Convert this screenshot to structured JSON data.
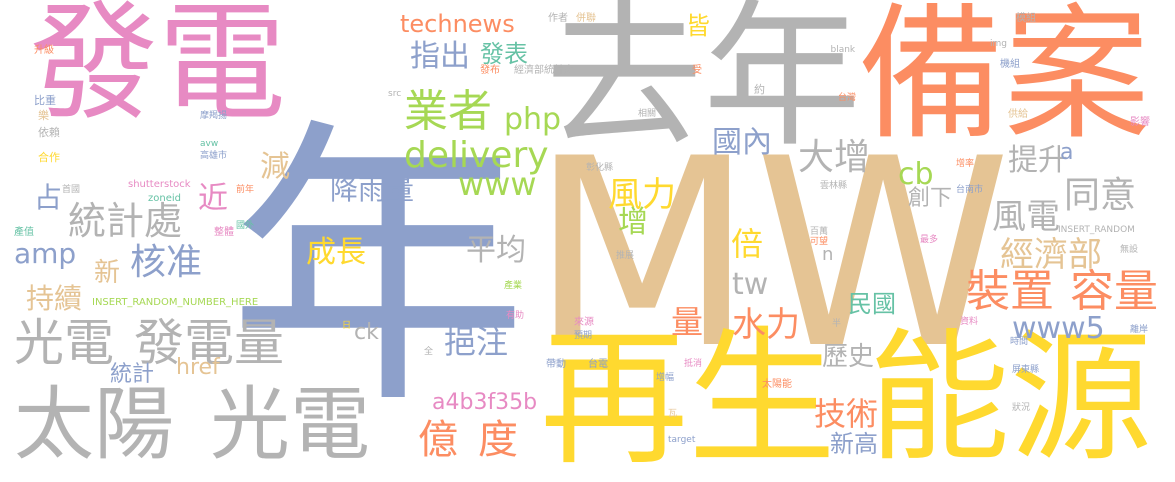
{
  "colors": {
    "pink": "#e78ac3",
    "orange": "#fc8d62",
    "gray": "#b3b3b3",
    "blue": "#8da0cb",
    "green": "#a6d854",
    "yellow": "#ffd92f",
    "tan": "#e5c494",
    "teal": "#66c2a5"
  },
  "words": [
    {
      "text": "發電",
      "color": "pink"
    },
    {
      "text": "去年",
      "color": "gray"
    },
    {
      "text": "備案",
      "color": "orange"
    },
    {
      "text": "年",
      "color": "blue"
    },
    {
      "text": "MW",
      "color": "tan"
    },
    {
      "text": "再生",
      "color": "yellow"
    },
    {
      "text": "能源",
      "color": "yellow"
    },
    {
      "text": "太陽",
      "color": "gray"
    },
    {
      "text": "光電",
      "color": "gray"
    },
    {
      "text": "光電",
      "color": "gray"
    },
    {
      "text": "發電量",
      "color": "gray"
    },
    {
      "text": "統計處",
      "color": "gray"
    },
    {
      "text": "核准",
      "color": "blue"
    },
    {
      "text": "業者",
      "color": "green"
    },
    {
      "text": "delivery",
      "color": "green"
    },
    {
      "text": "www",
      "color": "green"
    },
    {
      "text": "php",
      "color": "green"
    },
    {
      "text": "technews",
      "color": "orange"
    },
    {
      "text": "指出",
      "color": "blue"
    },
    {
      "text": "發表",
      "color": "teal"
    },
    {
      "text": "皆",
      "color": "yellow"
    },
    {
      "text": "國內",
      "color": "blue"
    },
    {
      "text": "大增",
      "color": "gray"
    },
    {
      "text": "提升",
      "color": "gray"
    },
    {
      "text": "同意",
      "color": "gray"
    },
    {
      "text": "風電",
      "color": "gray"
    },
    {
      "text": "經濟部",
      "color": "tan"
    },
    {
      "text": "cb",
      "color": "green"
    },
    {
      "text": "創下",
      "color": "gray"
    },
    {
      "text": "a",
      "color": "blue"
    },
    {
      "text": "風力",
      "color": "yellow"
    },
    {
      "text": "增",
      "color": "green"
    },
    {
      "text": "倍",
      "color": "yellow"
    },
    {
      "text": "裝置",
      "color": "orange"
    },
    {
      "text": "容量",
      "color": "orange"
    },
    {
      "text": "降雨量",
      "color": "blue"
    },
    {
      "text": "減",
      "color": "tan"
    },
    {
      "text": "近",
      "color": "pink"
    },
    {
      "text": "占",
      "color": "blue"
    },
    {
      "text": "amp",
      "color": "blue"
    },
    {
      "text": "新",
      "color": "tan"
    },
    {
      "text": "成長",
      "color": "yellow"
    },
    {
      "text": "平均",
      "color": "gray"
    },
    {
      "text": "持續",
      "color": "tan"
    },
    {
      "text": "tw",
      "color": "gray"
    },
    {
      "text": "n",
      "color": "gray"
    },
    {
      "text": "民國",
      "color": "teal"
    },
    {
      "text": "量",
      "color": "orange"
    },
    {
      "text": "水力",
      "color": "orange"
    },
    {
      "text": "www5",
      "color": "blue"
    },
    {
      "text": "ck",
      "color": "gray"
    },
    {
      "text": "挹注",
      "color": "blue"
    },
    {
      "text": "歷史",
      "color": "gray"
    },
    {
      "text": "統計",
      "color": "blue"
    },
    {
      "text": "href",
      "color": "tan"
    },
    {
      "text": "a4b3f35b",
      "color": "pink"
    },
    {
      "text": "億",
      "color": "orange"
    },
    {
      "text": "度",
      "color": "orange"
    },
    {
      "text": "技術",
      "color": "orange"
    },
    {
      "text": "新高",
      "color": "blue"
    },
    {
      "text": "升級",
      "color": "orange"
    },
    {
      "text": "比重",
      "color": "blue"
    },
    {
      "text": "樂",
      "color": "tan"
    },
    {
      "text": "依賴",
      "color": "gray"
    },
    {
      "text": "合作",
      "color": "yellow"
    },
    {
      "text": "首國",
      "color": "gray"
    },
    {
      "text": "產值",
      "color": "teal"
    },
    {
      "text": "INSERT_RANDOM_NUMBER_HERE",
      "color": "green"
    },
    {
      "text": "作者",
      "color": "gray"
    },
    {
      "text": "併聯",
      "color": "tan"
    },
    {
      "text": "發布",
      "color": "orange"
    },
    {
      "text": "經濟部統計處",
      "color": "gray"
    },
    {
      "text": "src",
      "color": "gray"
    },
    {
      "text": "受",
      "color": "orange"
    },
    {
      "text": "約",
      "color": "gray"
    },
    {
      "text": "相關",
      "color": "gray"
    },
    {
      "text": "_blank",
      "color": "gray"
    },
    {
      "text": "模組",
      "color": "gray"
    },
    {
      "text": "img",
      "color": "gray"
    },
    {
      "text": "機組",
      "color": "blue"
    },
    {
      "text": "台灣",
      "color": "orange"
    },
    {
      "text": "供給",
      "color": "tan"
    },
    {
      "text": "影響",
      "color": "pink"
    },
    {
      "text": "摩羯揚",
      "color": "blue"
    },
    {
      "text": "avw",
      "color": "teal"
    },
    {
      "text": "高雄市",
      "color": "blue"
    },
    {
      "text": "shutterstock",
      "color": "pink"
    },
    {
      "text": "zoneid",
      "color": "teal"
    },
    {
      "text": "前年",
      "color": "orange"
    },
    {
      "text": "彰化縣",
      "color": "gray"
    },
    {
      "text": "雲林縣",
      "color": "gray"
    },
    {
      "text": "增率",
      "color": "orange"
    },
    {
      "text": "台南市",
      "color": "blue"
    },
    {
      "text": "國外",
      "color": "teal"
    },
    {
      "text": "整體",
      "color": "pink"
    },
    {
      "text": "百萬",
      "color": "gray"
    },
    {
      "text": "可望",
      "color": "orange"
    },
    {
      "text": "最多",
      "color": "pink"
    },
    {
      "text": "INSERT_RANDOM",
      "color": "gray"
    },
    {
      "text": "無設",
      "color": "gray"
    },
    {
      "text": "推展",
      "color": "gray"
    },
    {
      "text": "產業",
      "color": "green"
    },
    {
      "text": "有助",
      "color": "pink"
    },
    {
      "text": "來源",
      "color": "pink"
    },
    {
      "text": "預期",
      "color": "blue"
    },
    {
      "text": "半",
      "color": "gray"
    },
    {
      "text": "資料",
      "color": "pink"
    },
    {
      "text": "離岸",
      "color": "blue"
    },
    {
      "text": "時間",
      "color": "blue"
    },
    {
      "text": "日",
      "color": "yellow"
    },
    {
      "text": "全",
      "color": "gray"
    },
    {
      "text": "帶動",
      "color": "blue"
    },
    {
      "text": "台電",
      "color": "blue"
    },
    {
      "text": "抵消",
      "color": "pink"
    },
    {
      "text": "增幅",
      "color": "blue"
    },
    {
      "text": "太陽能",
      "color": "orange"
    },
    {
      "text": "瓦",
      "color": "tan"
    },
    {
      "text": "target",
      "color": "blue"
    },
    {
      "text": "屏東縣",
      "color": "blue"
    },
    {
      "text": "狀況",
      "color": "gray"
    }
  ]
}
